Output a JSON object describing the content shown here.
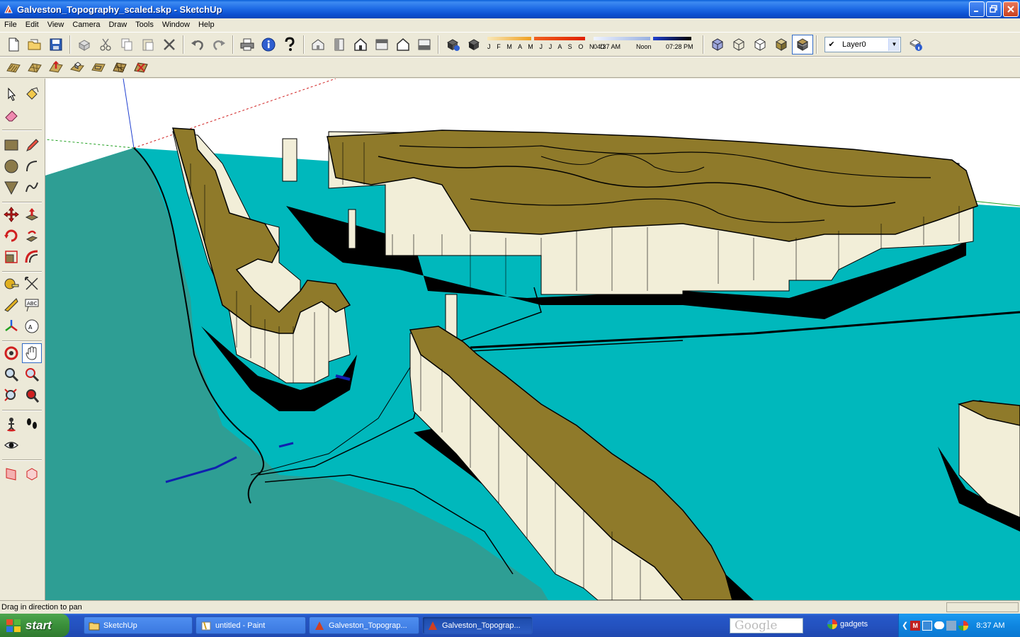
{
  "window": {
    "title": "Galveston_Topography_scaled.skp - SketchUp"
  },
  "menu": [
    "File",
    "Edit",
    "View",
    "Camera",
    "Draw",
    "Tools",
    "Window",
    "Help"
  ],
  "shadow": {
    "months": "J F M A M J J A S O N D",
    "time_start": "04:37 AM",
    "time_mid": "Noon",
    "time_end": "07:28 PM"
  },
  "layer": {
    "current": "Layer0"
  },
  "status": {
    "message": "Drag in direction to pan"
  },
  "taskbar": {
    "start": "start",
    "tasks": [
      {
        "label": "SketchUp",
        "icon": "folder-icon"
      },
      {
        "label": "untitled - Paint",
        "icon": "paint-icon"
      },
      {
        "label": "Galveston_Topograp...",
        "icon": "sketchup-icon"
      },
      {
        "label": "Galveston_Topograp...",
        "icon": "sketchup-icon"
      }
    ],
    "search_placeholder": "Google",
    "gadgets": "gadgets",
    "clock": "8:37 AM"
  },
  "colors": {
    "water": "#00b8bc",
    "water_dark": "#2e9e94",
    "terrain_top": "#8f7a2a",
    "terrain_side": "#f2eed8",
    "shadow": "#000000"
  }
}
